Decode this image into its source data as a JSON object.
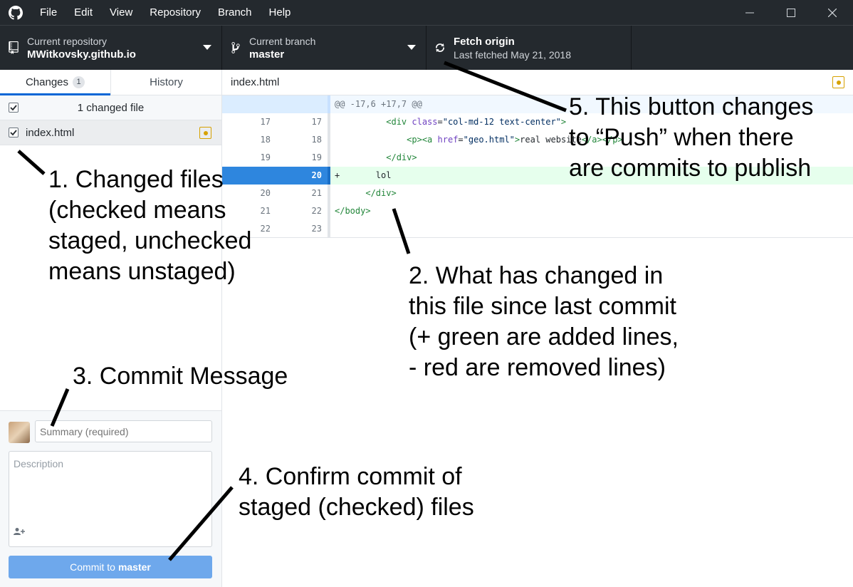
{
  "menu": [
    "File",
    "Edit",
    "View",
    "Repository",
    "Branch",
    "Help"
  ],
  "toolbar": {
    "repo_label": "Current repository",
    "repo_value": "MWitkovsky.github.io",
    "branch_label": "Current branch",
    "branch_value": "master",
    "fetch_title": "Fetch origin",
    "fetch_sub": "Last fetched May 21, 2018"
  },
  "sidebar": {
    "tabs": [
      {
        "label": "Changes",
        "badge": "1"
      },
      {
        "label": "History"
      }
    ],
    "changed_header": "1 changed file",
    "files": [
      {
        "name": "index.html",
        "checked": true
      }
    ]
  },
  "commit": {
    "summary_placeholder": "Summary (required)",
    "description_placeholder": "Description",
    "button_prefix": "Commit to",
    "button_branch": "master"
  },
  "diff": {
    "file": "index.html",
    "hunk": "@@ -17,6 +17,7 @@",
    "lines": [
      {
        "old": "17",
        "new": "17"
      },
      {
        "old": "18",
        "new": "18"
      },
      {
        "old": "19",
        "new": "19"
      },
      {
        "old": "",
        "new": "20",
        "text": "+       lol"
      },
      {
        "old": "20",
        "new": "21"
      },
      {
        "old": "21",
        "new": "22"
      },
      {
        "old": "22",
        "new": "23"
      }
    ],
    "code_fragments": {
      "l17_a": "<div ",
      "l17_attr": "class",
      "l17_b": "=",
      "l17_str": "\"col-md-12 text-center\"",
      "l17_c": ">",
      "l18_a": "<p><a ",
      "l18_attr": "href",
      "l18_b": "=",
      "l18_str": "\"geo.html\"",
      "l18_c": ">",
      "l18_text": "real website",
      "l18_end": "</a></p>",
      "l19": "</div>",
      "l21": "</div>",
      "l22": "</body>"
    }
  },
  "annotations": {
    "a1": "1. Changed files\n(checked means\nstaged, unchecked\nmeans unstaged)",
    "a2": "2. What has changed in\nthis file since last commit\n(+ green are added lines,\n- red are removed lines)",
    "a3": "3. Commit Message",
    "a4": "4. Confirm commit of\nstaged (checked) files",
    "a5": "5. This button changes\nto “Push” when there\nare commits to publish"
  },
  "colors": {
    "accent": "#0366d6",
    "added_bg": "#e6ffed",
    "modified": "#d6a100"
  }
}
